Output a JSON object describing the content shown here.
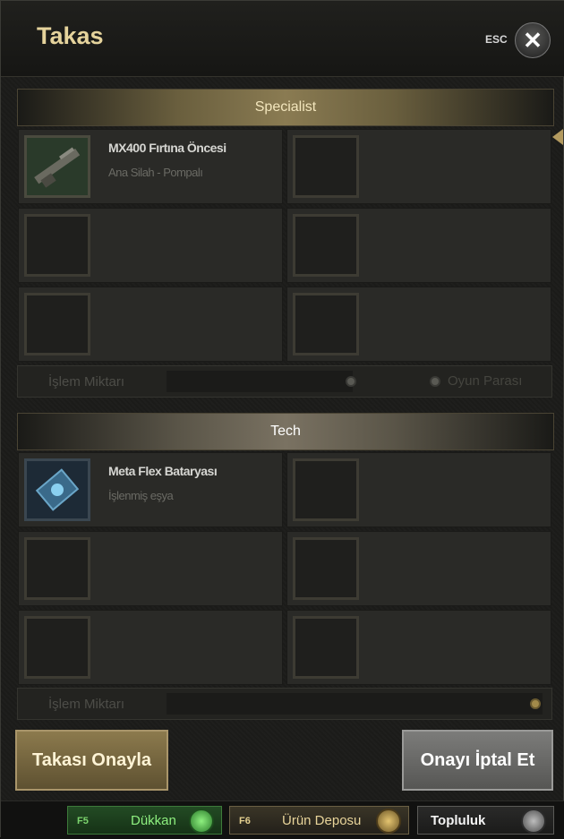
{
  "window": {
    "title": "Takas",
    "esc_label": "ESC",
    "close_glyph": "✕"
  },
  "sections": [
    {
      "title": "Specialist",
      "items": [
        {
          "name": "MX400 Fırtına Öncesi",
          "subtitle": "Ana Silah - Pompalı",
          "icon": "shotgun-icon"
        },
        {
          "name": "",
          "subtitle": "",
          "icon": ""
        },
        {
          "name": "",
          "subtitle": "",
          "icon": ""
        },
        {
          "name": "",
          "subtitle": "",
          "icon": ""
        },
        {
          "name": "",
          "subtitle": "",
          "icon": ""
        },
        {
          "name": "",
          "subtitle": "",
          "icon": ""
        }
      ],
      "quantity_label": "İşlem Miktarı",
      "currency_label": "Oyun Parası"
    },
    {
      "title": "Tech",
      "items": [
        {
          "name": "Meta Flex Bataryası",
          "subtitle": "İşlenmiş eşya",
          "icon": "battery-icon"
        },
        {
          "name": "",
          "subtitle": "",
          "icon": ""
        },
        {
          "name": "",
          "subtitle": "",
          "icon": ""
        },
        {
          "name": "",
          "subtitle": "",
          "icon": ""
        },
        {
          "name": "",
          "subtitle": "",
          "icon": ""
        },
        {
          "name": "",
          "subtitle": "",
          "icon": ""
        }
      ],
      "quantity_label": "İşlem Miktarı"
    }
  ],
  "buttons": {
    "confirm_label": "Takası Onayla",
    "cancel_label": "Onayı İptal Et"
  },
  "bottom_bar": {
    "shop": {
      "key": "F5",
      "label": "Dükkan",
      "icon": "shop-icon"
    },
    "depot": {
      "key": "F6",
      "label": "Ürün Deposu",
      "icon": "gem-icon"
    },
    "community": {
      "label": "Topluluk",
      "icon": "community-icon"
    }
  },
  "colors": {
    "title_gold": "#e5d39c",
    "confirm_button": "#8c7a4d",
    "cancel_button": "#7c7c7a",
    "shop_green": "#3d7a3a"
  }
}
